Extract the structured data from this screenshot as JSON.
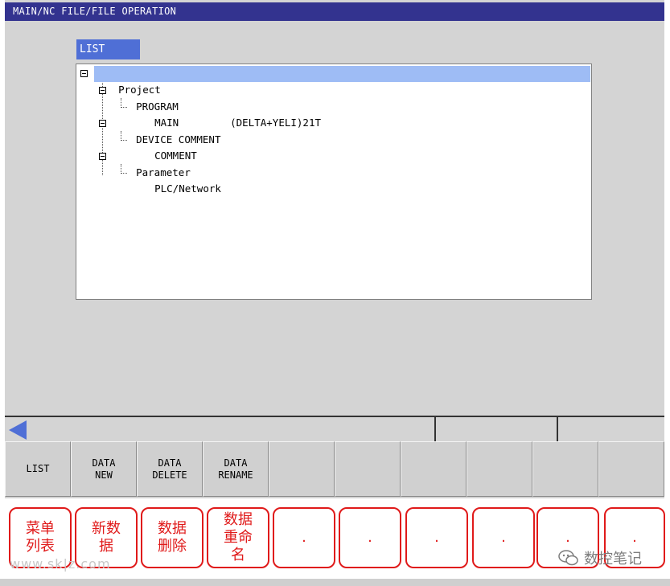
{
  "window": {
    "title": "MAIN/NC FILE/FILE OPERATION"
  },
  "list_tab": {
    "label": "LIST"
  },
  "tree": {
    "root": {
      "label": "Project"
    },
    "program": {
      "label": "PROGRAM",
      "child_name": "MAIN",
      "child_comment": "(DELTA+YELI)21T"
    },
    "device_comment": {
      "label": "DEVICE COMMENT",
      "child_name": "COMMENT"
    },
    "parameter": {
      "label": "Parameter",
      "child_name": "PLC/Network"
    }
  },
  "softkeys": [
    {
      "label": "LIST"
    },
    {
      "label": "DATA\nNEW"
    },
    {
      "label": "DATA\nDELETE"
    },
    {
      "label": "DATA\nRENAME"
    },
    {
      "label": ""
    },
    {
      "label": ""
    },
    {
      "label": ""
    },
    {
      "label": ""
    },
    {
      "label": ""
    },
    {
      "label": ""
    }
  ],
  "annotations": [
    {
      "text": "菜单\n列表"
    },
    {
      "text": "新数\n据"
    },
    {
      "text": "数据\n删除"
    },
    {
      "text": "数据\n重命\n名"
    },
    {
      "text": "."
    },
    {
      "text": "."
    },
    {
      "text": "."
    },
    {
      "text": "."
    },
    {
      "text": "."
    },
    {
      "text": "."
    }
  ],
  "watermarks": {
    "left": "www.sk|z.com",
    "right": "数控笔记"
  },
  "colors": {
    "title_bar": "#33338f",
    "selection": "#9ebcf5",
    "tab": "#4f6fd6",
    "annotation": "#e01a1a"
  }
}
